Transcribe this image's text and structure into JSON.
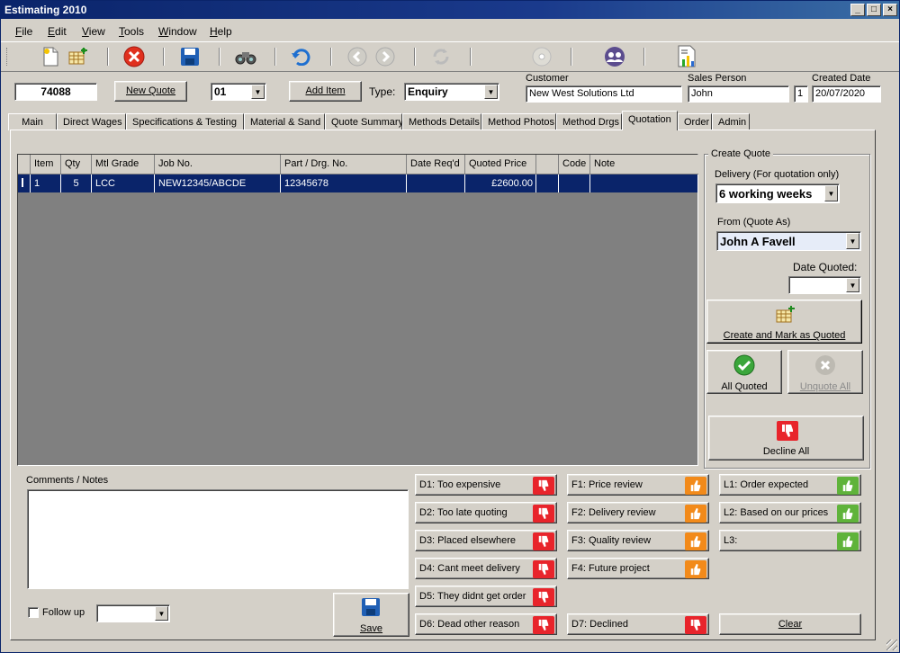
{
  "window": {
    "title": "Estimating 2010"
  },
  "menu": [
    {
      "label": "File",
      "u": "F",
      "rest": "ile"
    },
    {
      "label": "Edit",
      "u": "E",
      "rest": "dit"
    },
    {
      "label": "View",
      "u": "V",
      "rest": "iew"
    },
    {
      "label": "Tools",
      "u": "T",
      "rest": "ools"
    },
    {
      "label": "Window",
      "u": "W",
      "rest": "indow"
    },
    {
      "label": "Help",
      "u": "H",
      "rest": "elp"
    }
  ],
  "header": {
    "quote_number": "74088",
    "new_quote_label": "New Quote",
    "revision": "01",
    "add_item_label": "Add Item",
    "type_label": "Type:",
    "type_value": "Enquiry",
    "customer_label": "Customer",
    "customer_value": "New West Solutions Ltd",
    "sales_person_label": "Sales Person",
    "sales_person_value": "John",
    "sales_person_code": "1",
    "created_date_label": "Created Date",
    "created_date_value": "20/07/2020"
  },
  "tabs": [
    "Main",
    "Direct Wages",
    "Specifications & Testing",
    "Material & Sand",
    "Quote Summary",
    "Methods Details",
    "Method Photos",
    "Method Drgs",
    "Quotation",
    "Order",
    "Admin"
  ],
  "active_tab": "Quotation",
  "grid": {
    "columns": [
      "",
      "Item",
      "Qty",
      "Mtl Grade",
      "Job No.",
      "Part / Drg. No.",
      "Date Req'd",
      "Quoted Price",
      "",
      "Code",
      "Note"
    ],
    "rows": [
      [
        "",
        "1",
        "5",
        "LCC",
        "NEW12345/ABCDE",
        "12345678",
        "",
        "£2600.00",
        "",
        "",
        ""
      ]
    ]
  },
  "create_quote": {
    "group_label": "Create Quote",
    "delivery_label": "Delivery (For quotation only)",
    "delivery_value": "6 working weeks",
    "from_label": "From (Quote As)",
    "from_value": "John A Favell",
    "date_quoted_label": "Date Quoted:",
    "date_quoted_value": "",
    "create_mark_label": "Create and Mark as Quoted",
    "all_quoted_label": "All Quoted",
    "unquote_all_label": "Unquote All",
    "decline_all_label": "Decline All"
  },
  "comments": {
    "label": "Comments / Notes",
    "value": ""
  },
  "follow_up": {
    "label": "Follow up",
    "checked": false,
    "value": ""
  },
  "save_label": "Save",
  "reasons": {
    "declined": [
      "D1: Too expensive",
      "D2: Too late quoting",
      "D3: Placed elsewhere",
      "D4: Cant meet delivery",
      "D5: They didnt get order",
      "D6: Dead other reason"
    ],
    "followup": [
      "F1: Price review",
      "F2: Delivery review",
      "F3: Quality review",
      "F4: Future project"
    ],
    "d7": "D7: Declined",
    "likely": [
      "L1: Order expected",
      "L2: Based on our prices",
      "L3:"
    ],
    "clear_label": "Clear"
  },
  "colors": {
    "titlebar": "#0a246a",
    "selection": "#0a246a",
    "decline": "#e8242b",
    "review": "#f28a1a",
    "likely": "#5fb33a"
  }
}
